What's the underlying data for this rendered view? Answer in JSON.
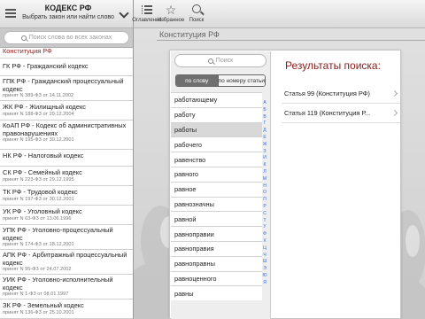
{
  "sidebar": {
    "title": "КОДЕКС РФ",
    "subtitle": "Выбрать закон или найти слово",
    "search_placeholder": "Поиск слова во всех законах",
    "items": [
      {
        "name": "Конституция РФ",
        "accepted": ""
      },
      {
        "name": "ГК РФ - Гражданский кодекс",
        "accepted": ""
      },
      {
        "name": "ГПК РФ - Гражданский процессуальный кодекс",
        "accepted": "принят N 389-ФЗ от 14.11.2002"
      },
      {
        "name": "ЖК РФ - Жилищный кодекс",
        "accepted": "принят N 188-ФЗ от 29.12.2004"
      },
      {
        "name": "КоАП РФ - Кодекс об административных правонарушениях",
        "accepted": "принят N 195-ФЗ от 30.12.2001"
      },
      {
        "name": "НК РФ - Налоговый кодекс",
        "accepted": ""
      },
      {
        "name": "СК РФ - Семейный кодекс",
        "accepted": "принят N 223-ФЗ от 29.12.1995"
      },
      {
        "name": "ТК РФ - Трудовой кодекс",
        "accepted": "принят N 197-ФЗ от 30.12.2001"
      },
      {
        "name": "УК РФ - Уголовный кодекс",
        "accepted": "принят N 63-ФЗ от 13.06.1996"
      },
      {
        "name": "УПК РФ - Уголовно-процессуальный кодекс",
        "accepted": "принят N 174-ФЗ от 18.12.2001"
      },
      {
        "name": "АПК РФ - Арбитражный процессуальный кодекс",
        "accepted": "принят N 95-ФЗ от 24.07.2002"
      },
      {
        "name": "УИК РФ - Уголовно-исполнительный кодекс",
        "accepted": "принят N 1-ФЗ от 08.01.1997"
      },
      {
        "name": "ЗК РФ - Земельный кодекс",
        "accepted": "принят N 136-ФЗ от 25.10.2001"
      }
    ]
  },
  "toolbar": {
    "toc_label": "Оглавление",
    "fav_label": "Избранное",
    "search_label": "Поиск"
  },
  "main": {
    "title": "Конституция РФ",
    "search_placeholder": "Поиск",
    "seg_by_word": "по слову",
    "seg_by_article": "по номеру статьи",
    "words": [
      "работающему",
      "работу",
      "работы",
      "рабочего",
      "равенство",
      "равного",
      "равное",
      "равнозначны",
      "равной",
      "равноправии",
      "равноправия",
      "равноправны",
      "равноценного",
      "равны"
    ],
    "selected_word": "работы",
    "alphabet": [
      "А",
      "Б",
      "В",
      "Г",
      "Д",
      "Е",
      "Ж",
      "З",
      "И",
      "К",
      "Л",
      "М",
      "Н",
      "О",
      "П",
      "Р",
      "С",
      "Т",
      "У",
      "Ф",
      "Х",
      "Ц",
      "Ч",
      "Ш",
      "Э",
      "Ю",
      "Я"
    ],
    "results_title": "Результаты поиска:",
    "results": [
      "Статья 99 (Конституция РФ)",
      "Статья 119 (Конституция Р..."
    ]
  },
  "colors": {
    "accent_red": "#8b1a1a",
    "index_blue": "#2a6fd6"
  }
}
